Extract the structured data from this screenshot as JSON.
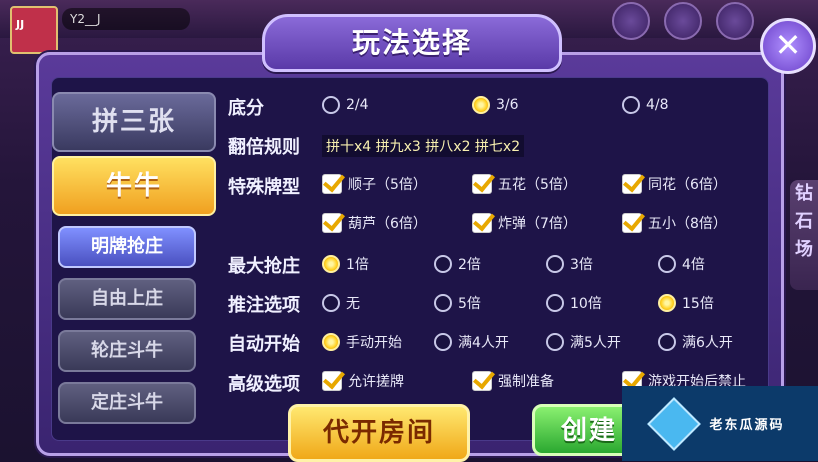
{
  "header": {
    "title": "玩法选择",
    "avatar_label": "JJ",
    "player_name": "Y2__J",
    "side_tab": "钻石场"
  },
  "game_tabs": [
    {
      "label": "拼三张",
      "active": false
    },
    {
      "label": "牛牛",
      "active": true
    }
  ],
  "modes": [
    {
      "label": "明牌抢庄",
      "active": true
    },
    {
      "label": "自由上庄",
      "active": false
    },
    {
      "label": "轮庄斗牛",
      "active": false
    },
    {
      "label": "定庄斗牛",
      "active": false
    }
  ],
  "rows": {
    "base_score": {
      "label": "底分",
      "options": [
        "2/4",
        "3/6",
        "4/8"
      ],
      "selected": 1
    },
    "multiplier_rule": {
      "label": "翻倍规则",
      "text": "拼十x4 拼九x3 拼八x2 拼七x2"
    },
    "special_type": {
      "label": "特殊牌型",
      "options": [
        "顺子（5倍）",
        "五花（5倍）",
        "同花（6倍）",
        "葫芦（6倍）",
        "炸弹（7倍）",
        "五小（8倍）"
      ]
    },
    "max_grab": {
      "label": "最大抢庄",
      "options": [
        "1倍",
        "2倍",
        "3倍",
        "4倍"
      ],
      "selected": 0
    },
    "bet_option": {
      "label": "推注选项",
      "options": [
        "无",
        "5倍",
        "10倍",
        "15倍"
      ],
      "selected": 3
    },
    "auto_start": {
      "label": "自动开始",
      "options": [
        "手动开始",
        "满4人开",
        "满5人开",
        "满6人开"
      ],
      "selected": 0
    },
    "advanced": {
      "label": "高级选项",
      "options": [
        "允许搓牌",
        "强制准备",
        "游戏开始后禁止"
      ]
    }
  },
  "buttons": {
    "proxy_room": "代开房间",
    "create": "创建"
  },
  "watermark": "老东瓜源码",
  "colors": {
    "accent_gold": "#ffd020",
    "dialog_purple": "#5a3a9a",
    "panel_dark": "#1e1448"
  }
}
